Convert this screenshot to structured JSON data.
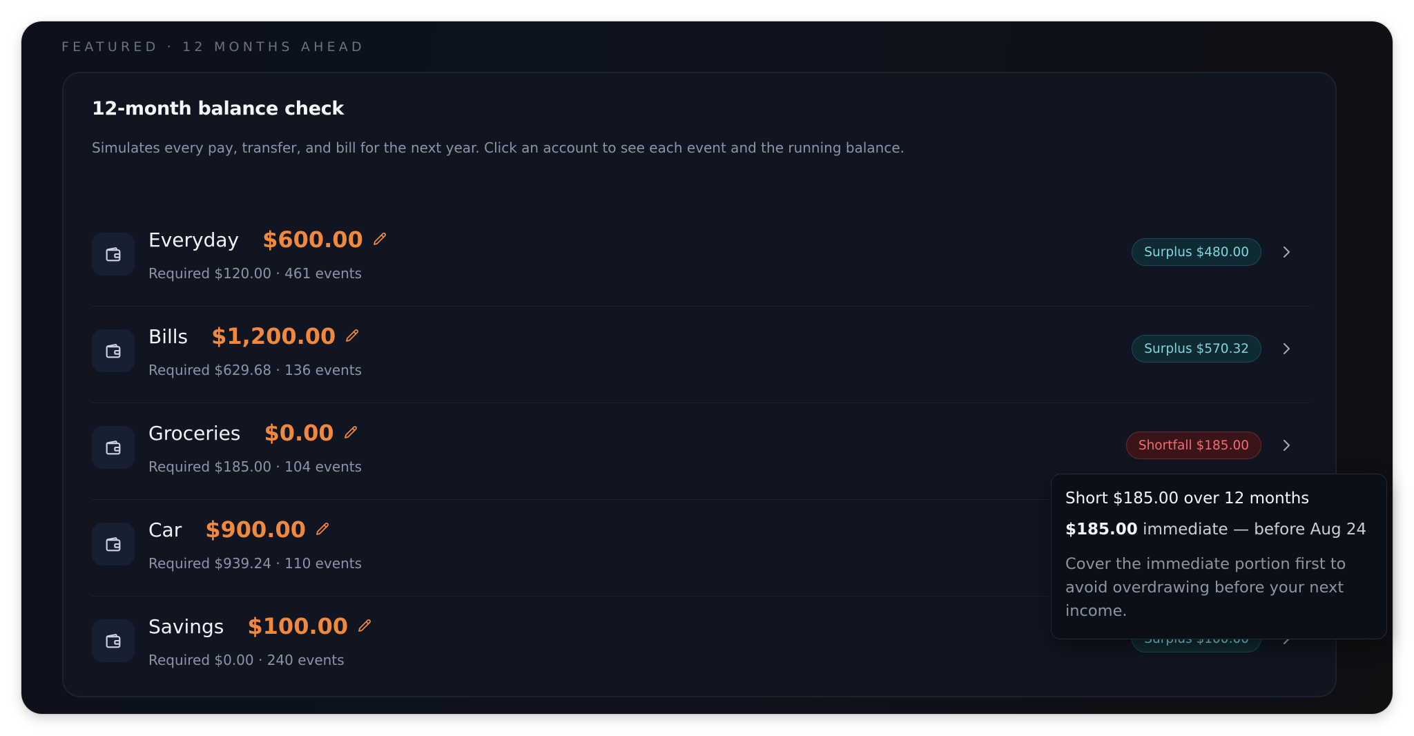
{
  "kicker": "FEATURED · 12 MONTHS AHEAD",
  "card": {
    "title": "12-month balance check",
    "description": "Simulates every pay, transfer, and bill for the next year. Click an account to see each event and the running balance."
  },
  "colors": {
    "balance": "#f0883e",
    "surplus": "#7ed6e2",
    "shortfall": "#f06c72",
    "background": "#0c111b"
  },
  "icons": {
    "account": "wallet-icon",
    "edit": "pencil-icon",
    "open": "chevron-right-icon"
  },
  "accounts": [
    {
      "name": "Everyday",
      "balance": "$600.00",
      "meta": "Required $120.00 · 461 events",
      "badge": "Surplus $480.00",
      "status": "surplus"
    },
    {
      "name": "Bills",
      "balance": "$1,200.00",
      "meta": "Required $629.68 · 136 events",
      "badge": "Surplus $570.32",
      "status": "surplus"
    },
    {
      "name": "Groceries",
      "balance": "$0.00",
      "meta": "Required $185.00 · 104 events",
      "badge": "Shortfall $185.00",
      "status": "shortfall"
    },
    {
      "name": "Car",
      "balance": "$900.00",
      "meta": "Required $939.24 · 110 events",
      "badge": "",
      "status": "hidden"
    },
    {
      "name": "Savings",
      "balance": "$100.00",
      "meta": "Required $0.00 · 240 events",
      "badge": "Surplus $100.00",
      "status": "surplus"
    }
  ],
  "tooltip": {
    "title": "Short $185.00 over 12 months",
    "amount": "$185.00",
    "amount_suffix": " immediate — before Aug 24",
    "body": "Cover the immediate portion first to avoid overdrawing before your next income."
  }
}
